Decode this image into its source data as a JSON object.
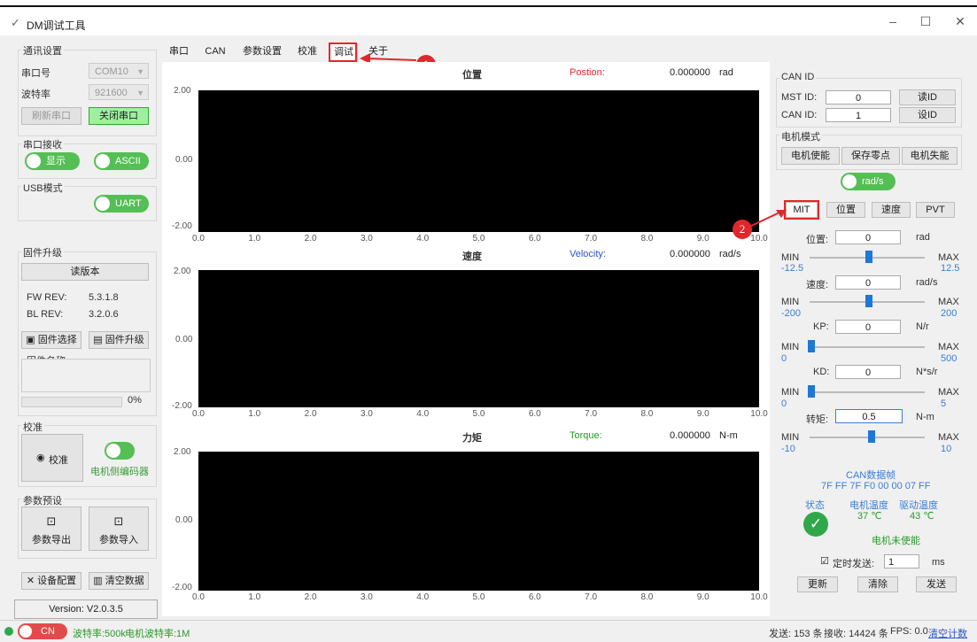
{
  "window": {
    "title": "DM调试工具",
    "icon": "app-icon",
    "min": "–",
    "max": "☐",
    "close": "✕"
  },
  "left": {
    "comm_title": "通讯设置",
    "port_label": "串口号",
    "port_value": "COM10",
    "baud_label": "波特率",
    "baud_value": "921600",
    "refresh_btn": "刷新串口",
    "close_btn": "关闭串口",
    "recv_title": "串口接收",
    "show_toggle": "显示",
    "ascii_toggle": "ASCII",
    "usb_title": "USB模式",
    "uart_toggle": "UART",
    "fw_title": "固件升级",
    "read_version_btn": "读版本",
    "fw_rev_label": "FW REV:",
    "fw_rev_value": "5.3.1.8",
    "bl_rev_label": "BL REV:",
    "bl_rev_value": "3.2.0.6",
    "fw_select_btn": "固件选择",
    "fw_upgrade_btn": "固件升级",
    "fw_name_label": "固件名称",
    "progress": "0%",
    "calib_title": "校准",
    "calib_radio": "校准",
    "encoder_label": "电机侧编码器",
    "preset_title": "参数预设",
    "export_btn": "参数导出",
    "import_btn": "参数导入",
    "device_cfg_btn": "设备配置",
    "clear_data_btn": "清空数据",
    "version": "Version: V2.0.3.5"
  },
  "tabs": [
    "串口",
    "CAN",
    "参数设置",
    "校准",
    "调试",
    "关于"
  ],
  "callouts": [
    "1",
    "2"
  ],
  "charts": [
    {
      "title": "位置",
      "name": "Postion:",
      "value": "0.000000",
      "unit": "rad",
      "color": "#e0282c"
    },
    {
      "title": "速度",
      "name": "Velocity:",
      "value": "0.000000",
      "unit": "rad/s",
      "color": "#2d55c8"
    },
    {
      "title": "力矩",
      "name": "Torque:",
      "value": "0.000000",
      "unit": "N-m",
      "color": "#1f9a1f"
    }
  ],
  "axis": {
    "y_ticks": [
      "2.00",
      "0.00",
      "-2.00"
    ],
    "x_ticks": [
      "0.0",
      "1.0",
      "2.0",
      "3.0",
      "4.0",
      "5.0",
      "6.0",
      "7.0",
      "8.0",
      "9.0",
      "10.0"
    ]
  },
  "right": {
    "canid_title": "CAN ID",
    "mst_label": "MST ID:",
    "mst_value": "0",
    "read_id_btn": "读ID",
    "can_label": "CAN ID:",
    "can_value": "1",
    "set_id_btn": "设ID",
    "mode_title": "电机模式",
    "enable_btn": "电机使能",
    "save_zero_btn": "保存零点",
    "disable_btn": "电机失能",
    "unit_toggle": "rad/s",
    "mode_tabs": [
      "MIT",
      "位置",
      "速度",
      "PVT"
    ],
    "params": [
      {
        "label": "位置:",
        "value": "0",
        "unit": "rad",
        "min": "-12.5",
        "max": "12.5",
        "pos": 0.5
      },
      {
        "label": "速度:",
        "value": "0",
        "unit": "rad/s",
        "min": "-200",
        "max": "200",
        "pos": 0.5
      },
      {
        "label": "KP:",
        "value": "0",
        "unit": "N/r",
        "min": "0",
        "max": "500",
        "pos": 0.0
      },
      {
        "label": "KD:",
        "value": "0",
        "unit": "N*s/r",
        "min": "0",
        "max": "5",
        "pos": 0.0
      },
      {
        "label": "转矩:",
        "value": "0.5",
        "unit": "N-m",
        "min": "-10",
        "max": "10",
        "pos": 0.52
      }
    ],
    "min_label": "MIN",
    "max_label": "MAX",
    "can_frame_title": "CAN数据帧",
    "can_frame": "7F FF 7F F0 00 00 07 FF",
    "state_label": "状态",
    "motor_temp_label": "电机温度",
    "driver_temp_label": "驱动温度",
    "motor_temp": "37 ℃",
    "driver_temp": "43 ℃",
    "motor_state": "电机未使能",
    "timed_send_label": "定时发送:",
    "timed_send_value": "1",
    "timed_send_unit": "ms",
    "update_btn": "更新",
    "clear_btn": "清除",
    "send_btn": "发送"
  },
  "status": {
    "can_toggle": "CN",
    "baud": "波特率:500k",
    "motor_baud": "电机波特率:1M",
    "send": "发送: 153 条",
    "recv": "接收: 14424 条",
    "fps": "FPS: 0.0",
    "clear_count": "清空计数"
  }
}
